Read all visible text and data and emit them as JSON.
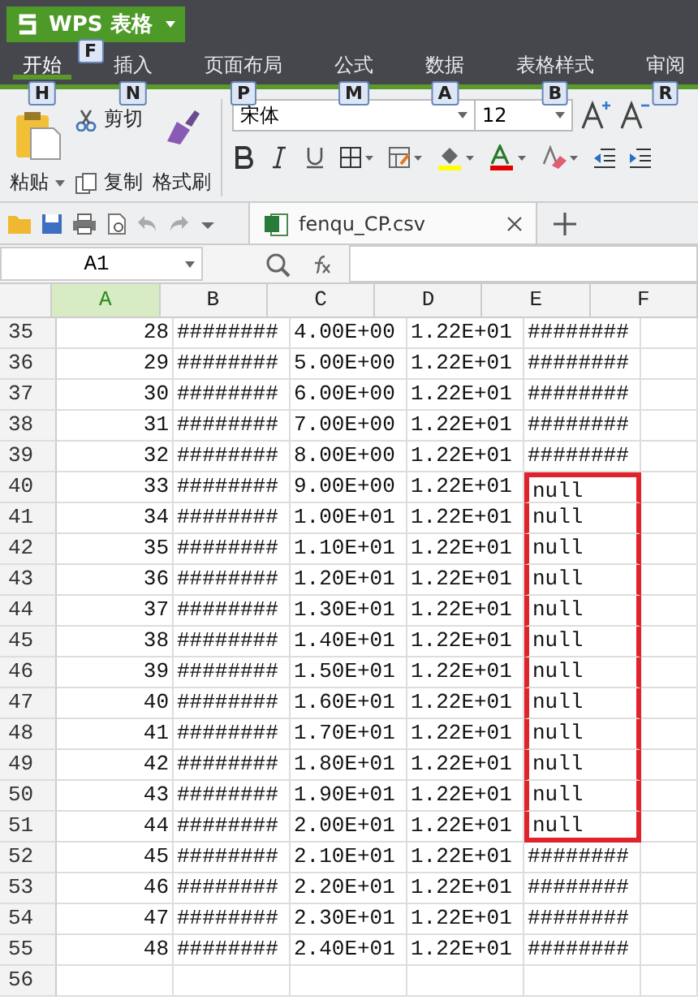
{
  "app_button": {
    "label": "WPS 表格",
    "key": "F"
  },
  "tabs": [
    {
      "label": "开始",
      "key": "H",
      "selected": true
    },
    {
      "label": "插入",
      "key": "N",
      "selected": false
    },
    {
      "label": "页面布局",
      "key": "P",
      "selected": false
    },
    {
      "label": "公式",
      "key": "M",
      "selected": false
    },
    {
      "label": "数据",
      "key": "A",
      "selected": false
    },
    {
      "label": "表格样式",
      "key": "B",
      "selected": false
    },
    {
      "label": "审阅",
      "key": "R",
      "selected": false
    }
  ],
  "ribbon": {
    "cut": "剪切",
    "paste": "粘贴",
    "copy": "复制",
    "format_painter": "格式刷",
    "font": "宋体",
    "size": "12"
  },
  "doc_tab": {
    "title": "fenqu_CP.csv"
  },
  "name_box": "A1",
  "columns": [
    {
      "label": "A",
      "selected": true
    },
    {
      "label": "B",
      "selected": false
    },
    {
      "label": "C",
      "selected": false
    },
    {
      "label": "D",
      "selected": false
    },
    {
      "label": "E",
      "selected": false
    },
    {
      "label": "F",
      "selected": false
    }
  ],
  "rows": [
    {
      "n": "35",
      "cells": [
        "28",
        "########",
        "4.00E+00",
        "1.22E+01",
        "########"
      ],
      "highlighted": false
    },
    {
      "n": "36",
      "cells": [
        "29",
        "########",
        "5.00E+00",
        "1.22E+01",
        "########"
      ],
      "highlighted": false
    },
    {
      "n": "37",
      "cells": [
        "30",
        "########",
        "6.00E+00",
        "1.22E+01",
        "########"
      ],
      "highlighted": false
    },
    {
      "n": "38",
      "cells": [
        "31",
        "########",
        "7.00E+00",
        "1.22E+01",
        "########"
      ],
      "highlighted": false
    },
    {
      "n": "39",
      "cells": [
        "32",
        "########",
        "8.00E+00",
        "1.22E+01",
        "########"
      ],
      "highlighted": false
    },
    {
      "n": "40",
      "cells": [
        "33",
        "########",
        "9.00E+00",
        "1.22E+01",
        "null"
      ],
      "highlighted": true
    },
    {
      "n": "41",
      "cells": [
        "34",
        "########",
        "1.00E+01",
        "1.22E+01",
        "null"
      ],
      "highlighted": true
    },
    {
      "n": "42",
      "cells": [
        "35",
        "########",
        "1.10E+01",
        "1.22E+01",
        "null"
      ],
      "highlighted": true
    },
    {
      "n": "43",
      "cells": [
        "36",
        "########",
        "1.20E+01",
        "1.22E+01",
        "null"
      ],
      "highlighted": true
    },
    {
      "n": "44",
      "cells": [
        "37",
        "########",
        "1.30E+01",
        "1.22E+01",
        "null"
      ],
      "highlighted": true
    },
    {
      "n": "45",
      "cells": [
        "38",
        "########",
        "1.40E+01",
        "1.22E+01",
        "null"
      ],
      "highlighted": true
    },
    {
      "n": "46",
      "cells": [
        "39",
        "########",
        "1.50E+01",
        "1.22E+01",
        "null"
      ],
      "highlighted": true
    },
    {
      "n": "47",
      "cells": [
        "40",
        "########",
        "1.60E+01",
        "1.22E+01",
        "null"
      ],
      "highlighted": true
    },
    {
      "n": "48",
      "cells": [
        "41",
        "########",
        "1.70E+01",
        "1.22E+01",
        "null"
      ],
      "highlighted": true
    },
    {
      "n": "49",
      "cells": [
        "42",
        "########",
        "1.80E+01",
        "1.22E+01",
        "null"
      ],
      "highlighted": true
    },
    {
      "n": "50",
      "cells": [
        "43",
        "########",
        "1.90E+01",
        "1.22E+01",
        "null"
      ],
      "highlighted": true
    },
    {
      "n": "51",
      "cells": [
        "44",
        "########",
        "2.00E+01",
        "1.22E+01",
        "null"
      ],
      "highlighted": true
    },
    {
      "n": "52",
      "cells": [
        "45",
        "########",
        "2.10E+01",
        "1.22E+01",
        "########"
      ],
      "highlighted": false
    },
    {
      "n": "53",
      "cells": [
        "46",
        "########",
        "2.20E+01",
        "1.22E+01",
        "########"
      ],
      "highlighted": false
    },
    {
      "n": "54",
      "cells": [
        "47",
        "########",
        "2.30E+01",
        "1.22E+01",
        "########"
      ],
      "highlighted": false
    },
    {
      "n": "55",
      "cells": [
        "48",
        "########",
        "2.40E+01",
        "1.22E+01",
        "########"
      ],
      "highlighted": false
    },
    {
      "n": "56",
      "cells": [
        "",
        "",
        "",
        "",
        ""
      ],
      "highlighted": false
    }
  ]
}
